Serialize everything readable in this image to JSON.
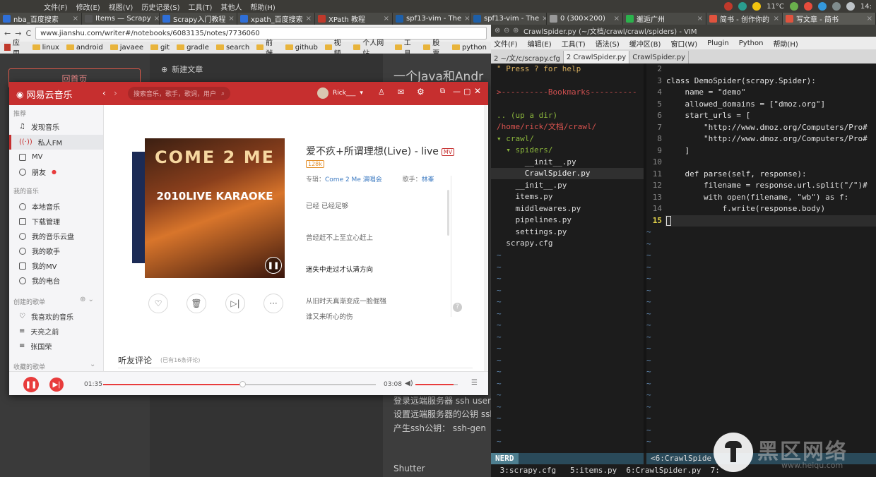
{
  "system": {
    "menu": [
      "文件(F)",
      "修改(E)",
      "视图(V)",
      "历史记录(S)",
      "工具(T)",
      "其他人",
      "帮助(H)"
    ],
    "weather": "11°C",
    "clock": "14:"
  },
  "browser_tabs": [
    {
      "label": "nba_百度搜索",
      "color": "#2f6fd8"
    },
    {
      "label": "Items — Scrapy",
      "color": "#555555"
    },
    {
      "label": "Scrapy入门教程",
      "color": "#2f6fd8"
    },
    {
      "label": "xpath_百度搜索",
      "color": "#2f6fd8"
    },
    {
      "label": "XPath 教程",
      "color": "#c0392b"
    },
    {
      "label": "spf13-vim - The",
      "color": "#1e5fa8"
    },
    {
      "label": "spf13-vim - The",
      "color": "#1e5fa8"
    },
    {
      "label": "0 (300×200)",
      "color": "#999999"
    },
    {
      "label": "邂逅广州",
      "color": "#2bb24c"
    },
    {
      "label": "简书 - 创作你的",
      "color": "#e0533e"
    },
    {
      "label": "写文章 - 简书",
      "color": "#e0533e"
    }
  ],
  "firefox": {
    "url": "www.jianshu.com/writer#/notebooks/6083135/notes/7736060",
    "bookmarks": [
      "应用",
      "linux",
      "android",
      "javaee",
      "git",
      "gradle",
      "search",
      "前端",
      "github",
      "视频",
      "个人网站",
      "工具",
      "股票",
      "python"
    ]
  },
  "jianshu": {
    "back_home": "回首页",
    "new_doc": "新建文章",
    "title": "一个Java和Andr",
    "lines": [
      "登录远端服务器 ssh user@",
      "设置远端服务器的公钥 ssh",
      "产生ssh公钥： ssh-gen",
      "Shutter"
    ]
  },
  "netease": {
    "logo": "网易云音乐",
    "search_placeholder": "搜索音乐，歌手，歌词，用户",
    "user": "Rick___",
    "sidebar": {
      "sec_recommend": "推荐",
      "recommend": [
        "发现音乐",
        "私人FM",
        "MV",
        "朋友"
      ],
      "sec_my": "我的音乐",
      "my": [
        "本地音乐",
        "下载管理",
        "我的音乐云盘",
        "我的歌手",
        "我的MV",
        "我的电台"
      ],
      "sec_created": "创建的歌单",
      "created": [
        "我喜欢的音乐",
        "天亮之前",
        "张国荣"
      ],
      "sec_collected": "收藏的歌单"
    },
    "song": {
      "title": "爱不疚+所谓理想(Live) - live",
      "mv": "MV",
      "quality": "128k",
      "album_label": "专辑：",
      "album": "Come 2 Me 演唱会",
      "artist_label": "歌手：",
      "artist": "林峯"
    },
    "cover": {
      "t1": "COME 2 ME",
      "t2": "2010LIVE KARAOKE"
    },
    "lyrics": [
      "已经 已经足够",
      "曾经赶不上至立心赶上",
      "迷失中走过才认清方向",
      "从旧时天真渐变成一脸倔强",
      "谁又来听心的伤"
    ],
    "comments_title": "听友评论",
    "comments_count": "(已有16条评论)",
    "time_current": "01:35",
    "time_total": "03:08",
    "progress": 0.51,
    "volume": 0.9
  },
  "vim": {
    "title": "CrawlSpider.py (~/文档/crawl/crawl/spiders) - VIM",
    "menu": [
      "文件(F)",
      "编辑(E)",
      "工具(T)",
      "语法(S)",
      "缓冲区(B)",
      "窗口(W)",
      "Plugin",
      "Python",
      "帮助(H)"
    ],
    "tabs": [
      "2 ~/文/c/scrapy.cfg",
      "2 CrawlSpider.py",
      "CrawlSpider.py"
    ],
    "tree": [
      "\" Press ? for help",
      "",
      ">----------Bookmarks----------",
      "",
      ".. (up a dir)",
      "/home/rick/文档/crawl/",
      "▾ crawl/",
      "  ▾ spiders/",
      "      __init__.py",
      "      CrawlSpider.py",
      "    __init__.py",
      "    items.py",
      "    middlewares.py",
      "    pipelines.py",
      "    settings.py",
      "  scrapy.cfg"
    ],
    "line_numbers": [
      "2",
      "3",
      "4",
      "5",
      "6",
      "7",
      "8",
      "9",
      "10",
      "11",
      "12",
      "13",
      "14",
      "15"
    ],
    "code": [
      "",
      "class DemoSpider(scrapy.Spider):",
      "    name = \"demo\"",
      "    allowed_domains = [\"dmoz.org\"]",
      "    start_urls = [",
      "        \"http://www.dmoz.org/Computers/Pro#",
      "        \"http://www.dmoz.org/Computers/Pro#",
      "    ]",
      "",
      "    def parse(self, response):",
      "        filename = response.url.split(\"/\")#",
      "        with open(filename, \"wb\") as f:",
      "            f.write(response.body)",
      ""
    ],
    "status_left": "NERD",
    "status_right": "<6:CrawlSpide",
    "cmdline": " 3:scrapy.cfg   5:items.py  6:CrawlSpider.py  7:"
  },
  "watermark": {
    "text": "黑区网络",
    "sub": "www.heiqu.com"
  },
  "colors": {
    "netease_red": "#c62f2f",
    "vim_bg": "#1c1c1c",
    "dir_green": "#8ab43c",
    "path_red": "#d9534f",
    "bookmark_red": "#d05050"
  }
}
